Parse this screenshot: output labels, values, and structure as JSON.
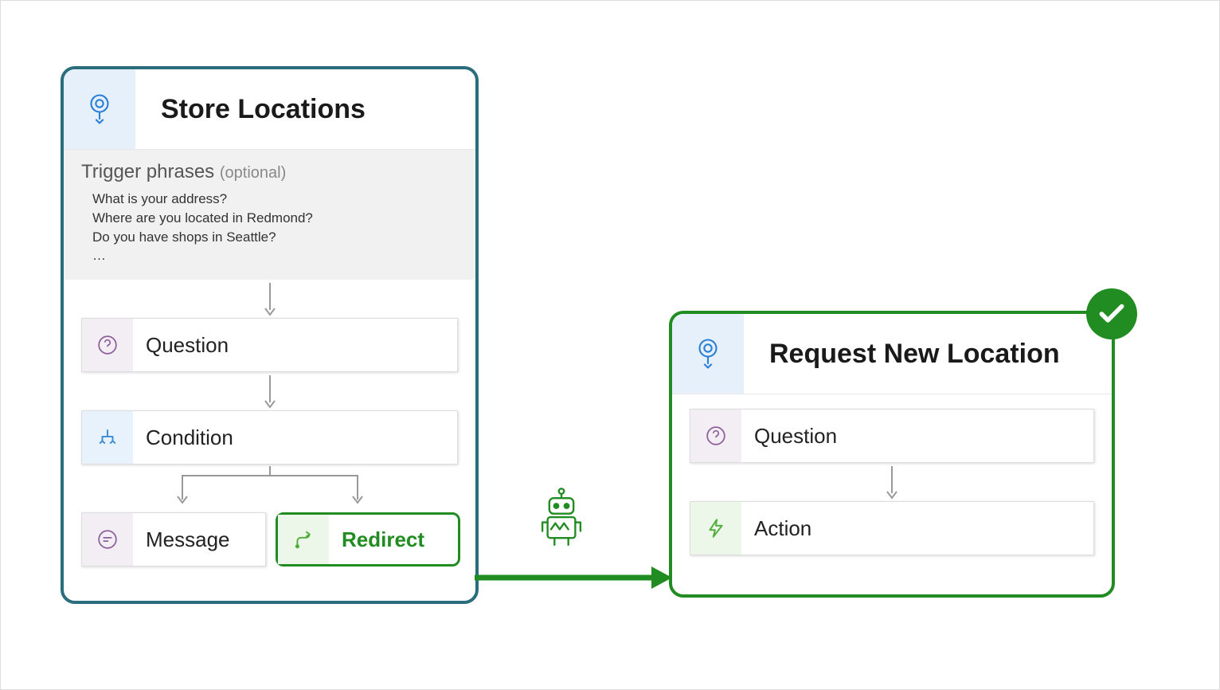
{
  "left_topic": {
    "title": "Store Locations",
    "trigger_label": "Trigger phrases",
    "trigger_optional": "(optional)",
    "trigger_phrases": [
      "What is your address?",
      "Where are you located in Redmond?",
      "Do you have shops in Seattle?",
      "…"
    ],
    "nodes": {
      "question": "Question",
      "condition": "Condition",
      "message": "Message",
      "redirect": "Redirect"
    }
  },
  "right_topic": {
    "title": "Request New Location",
    "nodes": {
      "question": "Question",
      "action": "Action"
    }
  }
}
